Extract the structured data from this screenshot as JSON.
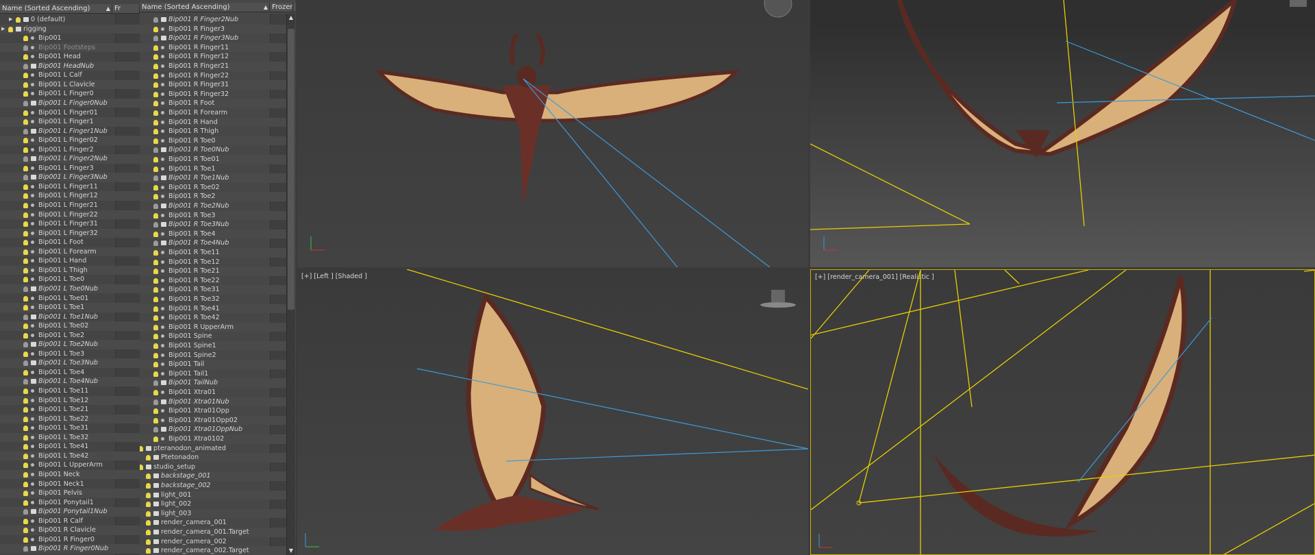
{
  "explorer_left": {
    "header": {
      "name": "Name (Sorted Ascending)",
      "frozen": "Fr"
    },
    "rows": [
      {
        "label": "0 (default)",
        "indent": 1,
        "kind": "layer"
      },
      {
        "label": "rigging",
        "indent": 0,
        "kind": "layer"
      },
      {
        "label": "Bip001",
        "indent": 2,
        "kind": "bone"
      },
      {
        "label": "Bip001 Footsteps",
        "indent": 2,
        "kind": "bone",
        "style": "dim"
      },
      {
        "label": "Bip001 Head",
        "indent": 2,
        "kind": "bone"
      },
      {
        "label": "Bip001 HeadNub",
        "indent": 2,
        "kind": "nub",
        "style": "italic"
      },
      {
        "label": "Bip001 L Calf",
        "indent": 2,
        "kind": "bone"
      },
      {
        "label": "Bip001 L Clavicle",
        "indent": 2,
        "kind": "bone"
      },
      {
        "label": "Bip001 L Finger0",
        "indent": 2,
        "kind": "bone"
      },
      {
        "label": "Bip001 L Finger0Nub",
        "indent": 2,
        "kind": "nub",
        "style": "italic"
      },
      {
        "label": "Bip001 L Finger01",
        "indent": 2,
        "kind": "bone"
      },
      {
        "label": "Bip001 L Finger1",
        "indent": 2,
        "kind": "bone"
      },
      {
        "label": "Bip001 L Finger1Nub",
        "indent": 2,
        "kind": "nub",
        "style": "italic"
      },
      {
        "label": "Bip001 L Finger02",
        "indent": 2,
        "kind": "bone"
      },
      {
        "label": "Bip001 L Finger2",
        "indent": 2,
        "kind": "bone"
      },
      {
        "label": "Bip001 L Finger2Nub",
        "indent": 2,
        "kind": "nub",
        "style": "italic"
      },
      {
        "label": "Bip001 L Finger3",
        "indent": 2,
        "kind": "bone"
      },
      {
        "label": "Bip001 L Finger3Nub",
        "indent": 2,
        "kind": "nub",
        "style": "italic"
      },
      {
        "label": "Bip001 L Finger11",
        "indent": 2,
        "kind": "bone"
      },
      {
        "label": "Bip001 L Finger12",
        "indent": 2,
        "kind": "bone"
      },
      {
        "label": "Bip001 L Finger21",
        "indent": 2,
        "kind": "bone"
      },
      {
        "label": "Bip001 L Finger22",
        "indent": 2,
        "kind": "bone"
      },
      {
        "label": "Bip001 L Finger31",
        "indent": 2,
        "kind": "bone"
      },
      {
        "label": "Bip001 L Finger32",
        "indent": 2,
        "kind": "bone"
      },
      {
        "label": "Bip001 L Foot",
        "indent": 2,
        "kind": "bone"
      },
      {
        "label": "Bip001 L Forearm",
        "indent": 2,
        "kind": "bone"
      },
      {
        "label": "Bip001 L Hand",
        "indent": 2,
        "kind": "bone"
      },
      {
        "label": "Bip001 L Thigh",
        "indent": 2,
        "kind": "bone"
      },
      {
        "label": "Bip001 L Toe0",
        "indent": 2,
        "kind": "bone"
      },
      {
        "label": "Bip001 L Toe0Nub",
        "indent": 2,
        "kind": "nub",
        "style": "italic"
      },
      {
        "label": "Bip001 L Toe01",
        "indent": 2,
        "kind": "bone"
      },
      {
        "label": "Bip001 L Toe1",
        "indent": 2,
        "kind": "bone"
      },
      {
        "label": "Bip001 L Toe1Nub",
        "indent": 2,
        "kind": "nub",
        "style": "italic"
      },
      {
        "label": "Bip001 L Toe02",
        "indent": 2,
        "kind": "bone"
      },
      {
        "label": "Bip001 L Toe2",
        "indent": 2,
        "kind": "bone"
      },
      {
        "label": "Bip001 L Toe2Nub",
        "indent": 2,
        "kind": "nub",
        "style": "italic"
      },
      {
        "label": "Bip001 L Toe3",
        "indent": 2,
        "kind": "bone"
      },
      {
        "label": "Bip001 L Toe3Nub",
        "indent": 2,
        "kind": "nub",
        "style": "italic"
      },
      {
        "label": "Bip001 L Toe4",
        "indent": 2,
        "kind": "bone"
      },
      {
        "label": "Bip001 L Toe4Nub",
        "indent": 2,
        "kind": "nub",
        "style": "italic"
      },
      {
        "label": "Bip001 L Toe11",
        "indent": 2,
        "kind": "bone"
      },
      {
        "label": "Bip001 L Toe12",
        "indent": 2,
        "kind": "bone"
      },
      {
        "label": "Bip001 L Toe21",
        "indent": 2,
        "kind": "bone"
      },
      {
        "label": "Bip001 L Toe22",
        "indent": 2,
        "kind": "bone"
      },
      {
        "label": "Bip001 L Toe31",
        "indent": 2,
        "kind": "bone"
      },
      {
        "label": "Bip001 L Toe32",
        "indent": 2,
        "kind": "bone"
      },
      {
        "label": "Bip001 L Toe41",
        "indent": 2,
        "kind": "bone"
      },
      {
        "label": "Bip001 L Toe42",
        "indent": 2,
        "kind": "bone"
      },
      {
        "label": "Bip001 L UpperArm",
        "indent": 2,
        "kind": "bone"
      },
      {
        "label": "Bip001 Neck",
        "indent": 2,
        "kind": "bone"
      },
      {
        "label": "Bip001 Neck1",
        "indent": 2,
        "kind": "bone"
      },
      {
        "label": "Bip001 Pelvis",
        "indent": 2,
        "kind": "bone"
      },
      {
        "label": "Bip001 Ponytail1",
        "indent": 2,
        "kind": "bone"
      },
      {
        "label": "Bip001 Ponytail1Nub",
        "indent": 2,
        "kind": "nub",
        "style": "italic"
      },
      {
        "label": "Bip001 R Calf",
        "indent": 2,
        "kind": "bone"
      },
      {
        "label": "Bip001 R Clavicle",
        "indent": 2,
        "kind": "bone"
      },
      {
        "label": "Bip001 R Finger0",
        "indent": 2,
        "kind": "bone"
      },
      {
        "label": "Bip001 R Finger0Nub",
        "indent": 2,
        "kind": "nub",
        "style": "italic"
      }
    ]
  },
  "explorer_right": {
    "header": {
      "name": "Name (Sorted Ascending)",
      "frozen": "Frozen"
    },
    "rows": [
      {
        "label": "Bip001 R Finger2Nub",
        "indent": 2,
        "kind": "nub",
        "style": "italic"
      },
      {
        "label": "Bip001 R Finger3",
        "indent": 2,
        "kind": "bone"
      },
      {
        "label": "Bip001 R Finger3Nub",
        "indent": 2,
        "kind": "nub",
        "style": "italic"
      },
      {
        "label": "Bip001 R Finger11",
        "indent": 2,
        "kind": "bone"
      },
      {
        "label": "Bip001 R Finger12",
        "indent": 2,
        "kind": "bone"
      },
      {
        "label": "Bip001 R Finger21",
        "indent": 2,
        "kind": "bone"
      },
      {
        "label": "Bip001 R Finger22",
        "indent": 2,
        "kind": "bone"
      },
      {
        "label": "Bip001 R Finger31",
        "indent": 2,
        "kind": "bone"
      },
      {
        "label": "Bip001 R Finger32",
        "indent": 2,
        "kind": "bone"
      },
      {
        "label": "Bip001 R Foot",
        "indent": 2,
        "kind": "bone"
      },
      {
        "label": "Bip001 R Forearm",
        "indent": 2,
        "kind": "bone"
      },
      {
        "label": "Bip001 R Hand",
        "indent": 2,
        "kind": "bone"
      },
      {
        "label": "Bip001 R Thigh",
        "indent": 2,
        "kind": "bone"
      },
      {
        "label": "Bip001 R Toe0",
        "indent": 2,
        "kind": "bone"
      },
      {
        "label": "Bip001 R Toe0Nub",
        "indent": 2,
        "kind": "nub",
        "style": "italic"
      },
      {
        "label": "Bip001 R Toe01",
        "indent": 2,
        "kind": "bone"
      },
      {
        "label": "Bip001 R Toe1",
        "indent": 2,
        "kind": "bone"
      },
      {
        "label": "Bip001 R Toe1Nub",
        "indent": 2,
        "kind": "nub",
        "style": "italic"
      },
      {
        "label": "Bip001 R Toe02",
        "indent": 2,
        "kind": "bone"
      },
      {
        "label": "Bip001 R Toe2",
        "indent": 2,
        "kind": "bone"
      },
      {
        "label": "Bip001 R Toe2Nub",
        "indent": 2,
        "kind": "nub",
        "style": "italic"
      },
      {
        "label": "Bip001 R Toe3",
        "indent": 2,
        "kind": "bone"
      },
      {
        "label": "Bip001 R Toe3Nub",
        "indent": 2,
        "kind": "nub",
        "style": "italic"
      },
      {
        "label": "Bip001 R Toe4",
        "indent": 2,
        "kind": "bone"
      },
      {
        "label": "Bip001 R Toe4Nub",
        "indent": 2,
        "kind": "nub",
        "style": "italic"
      },
      {
        "label": "Bip001 R Toe11",
        "indent": 2,
        "kind": "bone"
      },
      {
        "label": "Bip001 R Toe12",
        "indent": 2,
        "kind": "bone"
      },
      {
        "label": "Bip001 R Toe21",
        "indent": 2,
        "kind": "bone"
      },
      {
        "label": "Bip001 R Toe22",
        "indent": 2,
        "kind": "bone"
      },
      {
        "label": "Bip001 R Toe31",
        "indent": 2,
        "kind": "bone"
      },
      {
        "label": "Bip001 R Toe32",
        "indent": 2,
        "kind": "bone"
      },
      {
        "label": "Bip001 R Toe41",
        "indent": 2,
        "kind": "bone"
      },
      {
        "label": "Bip001 R Toe42",
        "indent": 2,
        "kind": "bone"
      },
      {
        "label": "Bip001 R UpperArm",
        "indent": 2,
        "kind": "bone"
      },
      {
        "label": "Bip001 Spine",
        "indent": 2,
        "kind": "bone"
      },
      {
        "label": "Bip001 Spine1",
        "indent": 2,
        "kind": "bone"
      },
      {
        "label": "Bip001 Spine2",
        "indent": 2,
        "kind": "bone"
      },
      {
        "label": "Bip001 Tail",
        "indent": 2,
        "kind": "bone"
      },
      {
        "label": "Bip001 Tail1",
        "indent": 2,
        "kind": "bone"
      },
      {
        "label": "Bip001 TailNub",
        "indent": 2,
        "kind": "nub",
        "style": "italic"
      },
      {
        "label": "Bip001 Xtra01",
        "indent": 2,
        "kind": "bone"
      },
      {
        "label": "Bip001 Xtra01Nub",
        "indent": 2,
        "kind": "nub",
        "style": "italic"
      },
      {
        "label": "Bip001 Xtra01Opp",
        "indent": 2,
        "kind": "bone"
      },
      {
        "label": "Bip001 Xtra01Opp02",
        "indent": 2,
        "kind": "bone"
      },
      {
        "label": "Bip001 Xtra01OppNub",
        "indent": 2,
        "kind": "nub",
        "style": "italic"
      },
      {
        "label": "Bip001 Xtra0102",
        "indent": 2,
        "kind": "bone"
      },
      {
        "label": "pteranodon_animated",
        "indent": 0,
        "kind": "layer"
      },
      {
        "label": "Ptetonadon",
        "indent": 1,
        "kind": "geo"
      },
      {
        "label": "studio_setup",
        "indent": 0,
        "kind": "layer"
      },
      {
        "label": "backstage_001",
        "indent": 1,
        "kind": "geo",
        "style": "italic"
      },
      {
        "label": "backstage_002",
        "indent": 1,
        "kind": "geo",
        "style": "italic"
      },
      {
        "label": "light_001",
        "indent": 1,
        "kind": "light"
      },
      {
        "label": "light_002",
        "indent": 1,
        "kind": "light"
      },
      {
        "label": "light_003",
        "indent": 1,
        "kind": "light"
      },
      {
        "label": "render_camera_001",
        "indent": 1,
        "kind": "camera"
      },
      {
        "label": "render_camera_001.Target",
        "indent": 1,
        "kind": "camera"
      },
      {
        "label": "render_camera_002",
        "indent": 1,
        "kind": "camera"
      },
      {
        "label": "render_camera_002.Target",
        "indent": 1,
        "kind": "camera"
      }
    ]
  },
  "viewports": {
    "top": {
      "label": ""
    },
    "perspective": {
      "label": ""
    },
    "left": {
      "label": "[+] [Left ] [Shaded ]"
    },
    "camera": {
      "label": "[+] [render_camera_001] [Realistic ]"
    }
  },
  "colors": {
    "selection": "#c9b200",
    "helper_line": "#3d9ad9",
    "wing_light": "#d9b07a",
    "wing_dark": "#5a2a22"
  }
}
